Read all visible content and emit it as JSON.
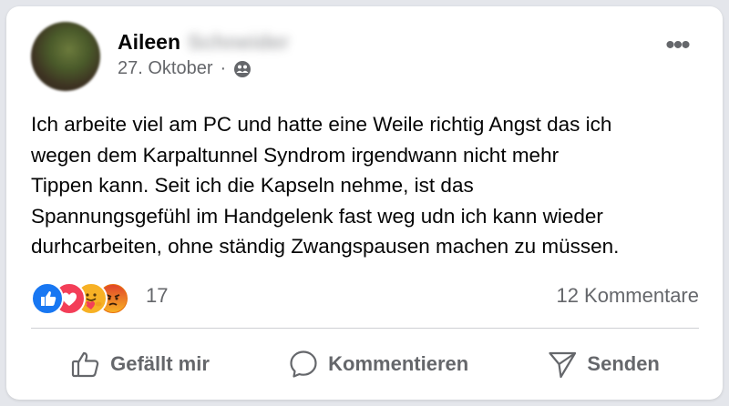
{
  "post": {
    "author_first": "Aileen",
    "author_last": "Schneider",
    "date": "27. Oktober",
    "separator": "·",
    "audience_icon": "friends-icon",
    "more_label": "•••",
    "text": "Ich arbeite viel am PC und hatte eine Weile richtig Angst das ich\nwegen dem Karpaltunnel Syndrom irgendwann nicht mehr\nTippen kann. Seit ich die Kapseln nehme, ist das\nSpannungsgefühl im Handgelenk fast weg udn ich kann wieder\ndurhcarbeiten, ohne ständig Zwangspausen machen zu müssen."
  },
  "reactions": {
    "icons": [
      "like-icon",
      "love-icon",
      "care-icon",
      "angry-icon"
    ],
    "count": "17",
    "comments": "12 Kommentare"
  },
  "colors": {
    "like": "#1877f2",
    "love": "#f33e58",
    "care": "#f7b125",
    "angry": "#e9710f",
    "muted_text": "#65676b"
  },
  "actions": {
    "like_label": "Gefällt mir",
    "comment_label": "Kommentieren",
    "send_label": "Senden"
  }
}
